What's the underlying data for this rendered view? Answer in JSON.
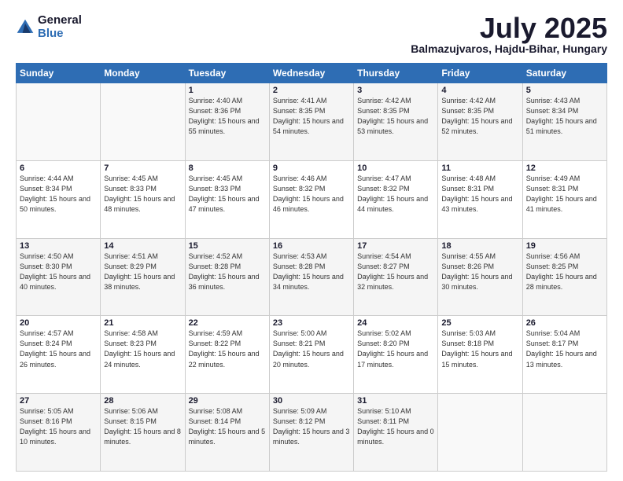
{
  "logo": {
    "general": "General",
    "blue": "Blue"
  },
  "header": {
    "month": "July 2025",
    "location": "Balmazujvaros, Hajdu-Bihar, Hungary"
  },
  "weekdays": [
    "Sunday",
    "Monday",
    "Tuesday",
    "Wednesday",
    "Thursday",
    "Friday",
    "Saturday"
  ],
  "weeks": [
    [
      {
        "day": "",
        "sunrise": "",
        "sunset": "",
        "daylight": ""
      },
      {
        "day": "",
        "sunrise": "",
        "sunset": "",
        "daylight": ""
      },
      {
        "day": "1",
        "sunrise": "Sunrise: 4:40 AM",
        "sunset": "Sunset: 8:36 PM",
        "daylight": "Daylight: 15 hours and 55 minutes."
      },
      {
        "day": "2",
        "sunrise": "Sunrise: 4:41 AM",
        "sunset": "Sunset: 8:35 PM",
        "daylight": "Daylight: 15 hours and 54 minutes."
      },
      {
        "day": "3",
        "sunrise": "Sunrise: 4:42 AM",
        "sunset": "Sunset: 8:35 PM",
        "daylight": "Daylight: 15 hours and 53 minutes."
      },
      {
        "day": "4",
        "sunrise": "Sunrise: 4:42 AM",
        "sunset": "Sunset: 8:35 PM",
        "daylight": "Daylight: 15 hours and 52 minutes."
      },
      {
        "day": "5",
        "sunrise": "Sunrise: 4:43 AM",
        "sunset": "Sunset: 8:34 PM",
        "daylight": "Daylight: 15 hours and 51 minutes."
      }
    ],
    [
      {
        "day": "6",
        "sunrise": "Sunrise: 4:44 AM",
        "sunset": "Sunset: 8:34 PM",
        "daylight": "Daylight: 15 hours and 50 minutes."
      },
      {
        "day": "7",
        "sunrise": "Sunrise: 4:45 AM",
        "sunset": "Sunset: 8:33 PM",
        "daylight": "Daylight: 15 hours and 48 minutes."
      },
      {
        "day": "8",
        "sunrise": "Sunrise: 4:45 AM",
        "sunset": "Sunset: 8:33 PM",
        "daylight": "Daylight: 15 hours and 47 minutes."
      },
      {
        "day": "9",
        "sunrise": "Sunrise: 4:46 AM",
        "sunset": "Sunset: 8:32 PM",
        "daylight": "Daylight: 15 hours and 46 minutes."
      },
      {
        "day": "10",
        "sunrise": "Sunrise: 4:47 AM",
        "sunset": "Sunset: 8:32 PM",
        "daylight": "Daylight: 15 hours and 44 minutes."
      },
      {
        "day": "11",
        "sunrise": "Sunrise: 4:48 AM",
        "sunset": "Sunset: 8:31 PM",
        "daylight": "Daylight: 15 hours and 43 minutes."
      },
      {
        "day": "12",
        "sunrise": "Sunrise: 4:49 AM",
        "sunset": "Sunset: 8:31 PM",
        "daylight": "Daylight: 15 hours and 41 minutes."
      }
    ],
    [
      {
        "day": "13",
        "sunrise": "Sunrise: 4:50 AM",
        "sunset": "Sunset: 8:30 PM",
        "daylight": "Daylight: 15 hours and 40 minutes."
      },
      {
        "day": "14",
        "sunrise": "Sunrise: 4:51 AM",
        "sunset": "Sunset: 8:29 PM",
        "daylight": "Daylight: 15 hours and 38 minutes."
      },
      {
        "day": "15",
        "sunrise": "Sunrise: 4:52 AM",
        "sunset": "Sunset: 8:28 PM",
        "daylight": "Daylight: 15 hours and 36 minutes."
      },
      {
        "day": "16",
        "sunrise": "Sunrise: 4:53 AM",
        "sunset": "Sunset: 8:28 PM",
        "daylight": "Daylight: 15 hours and 34 minutes."
      },
      {
        "day": "17",
        "sunrise": "Sunrise: 4:54 AM",
        "sunset": "Sunset: 8:27 PM",
        "daylight": "Daylight: 15 hours and 32 minutes."
      },
      {
        "day": "18",
        "sunrise": "Sunrise: 4:55 AM",
        "sunset": "Sunset: 8:26 PM",
        "daylight": "Daylight: 15 hours and 30 minutes."
      },
      {
        "day": "19",
        "sunrise": "Sunrise: 4:56 AM",
        "sunset": "Sunset: 8:25 PM",
        "daylight": "Daylight: 15 hours and 28 minutes."
      }
    ],
    [
      {
        "day": "20",
        "sunrise": "Sunrise: 4:57 AM",
        "sunset": "Sunset: 8:24 PM",
        "daylight": "Daylight: 15 hours and 26 minutes."
      },
      {
        "day": "21",
        "sunrise": "Sunrise: 4:58 AM",
        "sunset": "Sunset: 8:23 PM",
        "daylight": "Daylight: 15 hours and 24 minutes."
      },
      {
        "day": "22",
        "sunrise": "Sunrise: 4:59 AM",
        "sunset": "Sunset: 8:22 PM",
        "daylight": "Daylight: 15 hours and 22 minutes."
      },
      {
        "day": "23",
        "sunrise": "Sunrise: 5:00 AM",
        "sunset": "Sunset: 8:21 PM",
        "daylight": "Daylight: 15 hours and 20 minutes."
      },
      {
        "day": "24",
        "sunrise": "Sunrise: 5:02 AM",
        "sunset": "Sunset: 8:20 PM",
        "daylight": "Daylight: 15 hours and 17 minutes."
      },
      {
        "day": "25",
        "sunrise": "Sunrise: 5:03 AM",
        "sunset": "Sunset: 8:18 PM",
        "daylight": "Daylight: 15 hours and 15 minutes."
      },
      {
        "day": "26",
        "sunrise": "Sunrise: 5:04 AM",
        "sunset": "Sunset: 8:17 PM",
        "daylight": "Daylight: 15 hours and 13 minutes."
      }
    ],
    [
      {
        "day": "27",
        "sunrise": "Sunrise: 5:05 AM",
        "sunset": "Sunset: 8:16 PM",
        "daylight": "Daylight: 15 hours and 10 minutes."
      },
      {
        "day": "28",
        "sunrise": "Sunrise: 5:06 AM",
        "sunset": "Sunset: 8:15 PM",
        "daylight": "Daylight: 15 hours and 8 minutes."
      },
      {
        "day": "29",
        "sunrise": "Sunrise: 5:08 AM",
        "sunset": "Sunset: 8:14 PM",
        "daylight": "Daylight: 15 hours and 5 minutes."
      },
      {
        "day": "30",
        "sunrise": "Sunrise: 5:09 AM",
        "sunset": "Sunset: 8:12 PM",
        "daylight": "Daylight: 15 hours and 3 minutes."
      },
      {
        "day": "31",
        "sunrise": "Sunrise: 5:10 AM",
        "sunset": "Sunset: 8:11 PM",
        "daylight": "Daylight: 15 hours and 0 minutes."
      },
      {
        "day": "",
        "sunrise": "",
        "sunset": "",
        "daylight": ""
      },
      {
        "day": "",
        "sunrise": "",
        "sunset": "",
        "daylight": ""
      }
    ]
  ]
}
